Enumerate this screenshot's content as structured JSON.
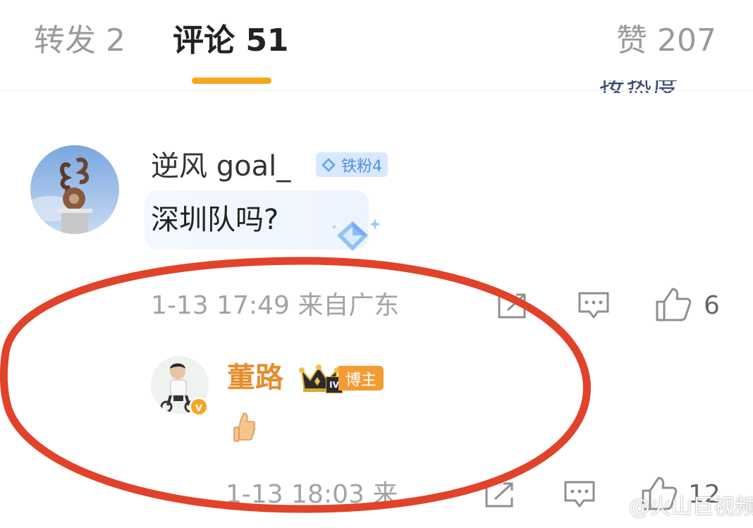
{
  "tabs": {
    "repost": "转发 2",
    "comments": "评论 51",
    "likes": "赞 207"
  },
  "sort_label_partial": "按热度",
  "comment": {
    "username": "逆风 goal_",
    "badge": "铁粉4",
    "text": "深圳队吗?",
    "meta": "1-13 17:49 来自广东",
    "likes": "6",
    "icons": [
      "share-icon",
      "comment-icon",
      "like-icon"
    ]
  },
  "reply": {
    "username": "董路",
    "level_badge": "IV",
    "verified_mark": "v",
    "badge": "博主",
    "content_emoji": "thumbs-up",
    "meta": "1-13 18:03 来...",
    "likes": "12",
    "icons": [
      "share-icon",
      "comment-icon",
      "like-icon"
    ]
  },
  "annotation": {
    "type": "red-ellipse",
    "color": "#e0432a"
  },
  "watermark": "@火山巨视频",
  "colors": {
    "accent": "#f6a51e",
    "fan_badge": "#4f8ee6",
    "blogger_name": "#e68d2c",
    "muted": "#a3a3a3"
  }
}
